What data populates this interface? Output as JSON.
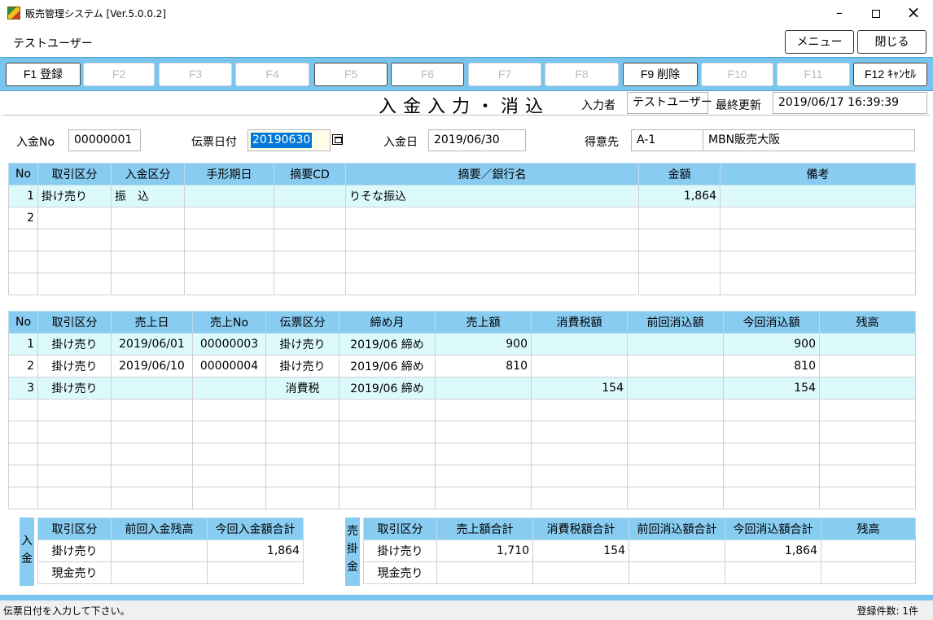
{
  "window": {
    "title": "販売管理システム [Ver.5.0.0.2]"
  },
  "user": "テストユーザー",
  "top_buttons": {
    "menu": "メニュー",
    "close": "閉じる"
  },
  "fkeys": [
    "F1 登録",
    "F2",
    "F3",
    "F4",
    "F5",
    "F6",
    "F7",
    "F8",
    "F9 削除",
    "F10",
    "F11",
    "F12 ｷｬﾝｾﾙ"
  ],
  "screen_title": "入金入力・消込",
  "header": {
    "inputter_label": "入力者",
    "inputter": "テストユーザー",
    "updated_label": "最終更新",
    "updated": "2019/06/17 16:39:39"
  },
  "form": {
    "no_label": "入金No",
    "no": "00000001",
    "slip_date_label": "伝票日付",
    "slip_date": "20190630",
    "pay_date_label": "入金日",
    "pay_date": "2019/06/30",
    "customer_label": "得意先",
    "customer_code": "A-1",
    "customer_name": "MBN販売大阪"
  },
  "payment_table": {
    "columns": [
      "No",
      "取引区分",
      "入金区分",
      "手形期日",
      "摘要CD",
      "摘要／銀行名",
      "金額",
      "備考"
    ],
    "rows": [
      [
        "1",
        "掛け売り",
        "振　込",
        "",
        "",
        "りそな振込",
        "1,864",
        ""
      ],
      [
        "2",
        "",
        "",
        "",
        "",
        "",
        "",
        ""
      ]
    ]
  },
  "sales_table": {
    "columns": [
      "No",
      "取引区分",
      "売上日",
      "売上No",
      "伝票区分",
      "締め月",
      "売上額",
      "消費税額",
      "前回消込額",
      "今回消込額",
      "残高"
    ],
    "rows": [
      [
        "1",
        "掛け売り",
        "2019/06/01",
        "00000003",
        "掛け売り",
        "2019/06 締め",
        "900",
        "",
        "",
        "900",
        ""
      ],
      [
        "2",
        "掛け売り",
        "2019/06/10",
        "00000004",
        "掛け売り",
        "2019/06 締め",
        "810",
        "",
        "",
        "810",
        ""
      ],
      [
        "3",
        "掛け売り",
        "",
        "",
        "消費税",
        "2019/06 締め",
        "",
        "154",
        "",
        "154",
        ""
      ]
    ]
  },
  "deposit_summary": {
    "side_label": [
      "入",
      "金"
    ],
    "columns": [
      "取引区分",
      "前回入金残高",
      "今回入金額合計"
    ],
    "rows": [
      [
        "掛け売り",
        "",
        "1,864"
      ],
      [
        "現金売り",
        "",
        ""
      ]
    ]
  },
  "receivable_summary": {
    "side_label": [
      "売",
      "掛",
      "金"
    ],
    "columns": [
      "取引区分",
      "売上額合計",
      "消費税額合計",
      "前回消込額合計",
      "今回消込額合計",
      "残高"
    ],
    "rows": [
      [
        "掛け売り",
        "1,710",
        "154",
        "",
        "1,864",
        ""
      ],
      [
        "現金売り",
        "",
        "",
        "",
        "",
        ""
      ]
    ]
  },
  "status": {
    "message": "伝票日付を入力して下さい。",
    "count": "登録件数: 1件"
  },
  "colors": {
    "accent": "#79c5ee",
    "header": "#89ccf2",
    "row_alt": "#dcfafc",
    "selection": "#0078d7"
  },
  "icons": {
    "app": "app-icon",
    "minimize": "minimize-icon",
    "maximize": "maximize-icon",
    "close": "close-icon",
    "calendar": "calendar-icon"
  }
}
